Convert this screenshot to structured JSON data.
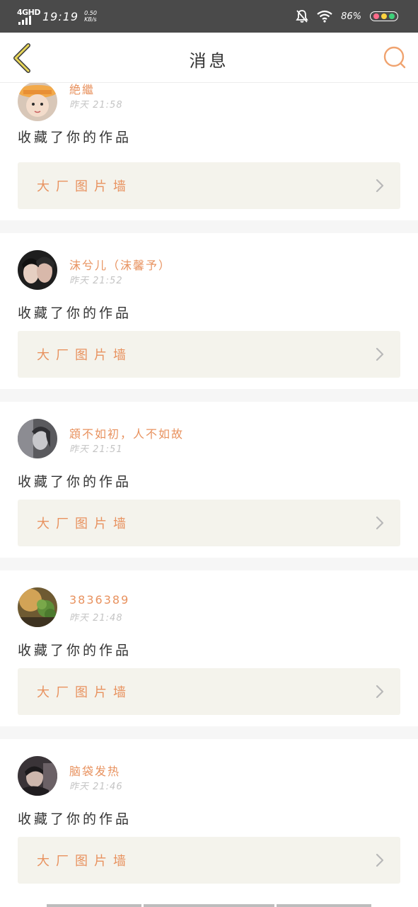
{
  "status_bar": {
    "network": "4GHD",
    "time": "19:19",
    "speed_value": "0.50",
    "speed_unit": "KB/s",
    "battery": "86%"
  },
  "header": {
    "title": "消息"
  },
  "notifications": [
    {
      "username": "絶繼",
      "time": "昨天 21:58",
      "action": "收藏了你的作品",
      "work_title": "大厂图片墙"
    },
    {
      "username": "沫兮儿（沫馨予）",
      "time": "昨天 21:52",
      "action": "收藏了你的作品",
      "work_title": "大厂图片墙"
    },
    {
      "username": "顁不如初，人不如故",
      "time": "昨天 21:51",
      "action": "收藏了你的作品",
      "work_title": "大厂图片墙"
    },
    {
      "username": "3836389",
      "time": "昨天 21:48",
      "action": "收藏了你的作品",
      "work_title": "大厂图片墙"
    },
    {
      "username": "脑袋发热",
      "time": "昨天 21:46",
      "action": "收藏了你的作品",
      "work_title": "大厂图片墙"
    }
  ],
  "colors": {
    "accent": "#e8925f",
    "status_bar_bg": "#4a4a4a",
    "card_link_bg": "#f4f3ec"
  },
  "icons": {
    "back": "chevron-left-icon",
    "search": "search-icon",
    "arrow": "chevron-right-icon"
  }
}
